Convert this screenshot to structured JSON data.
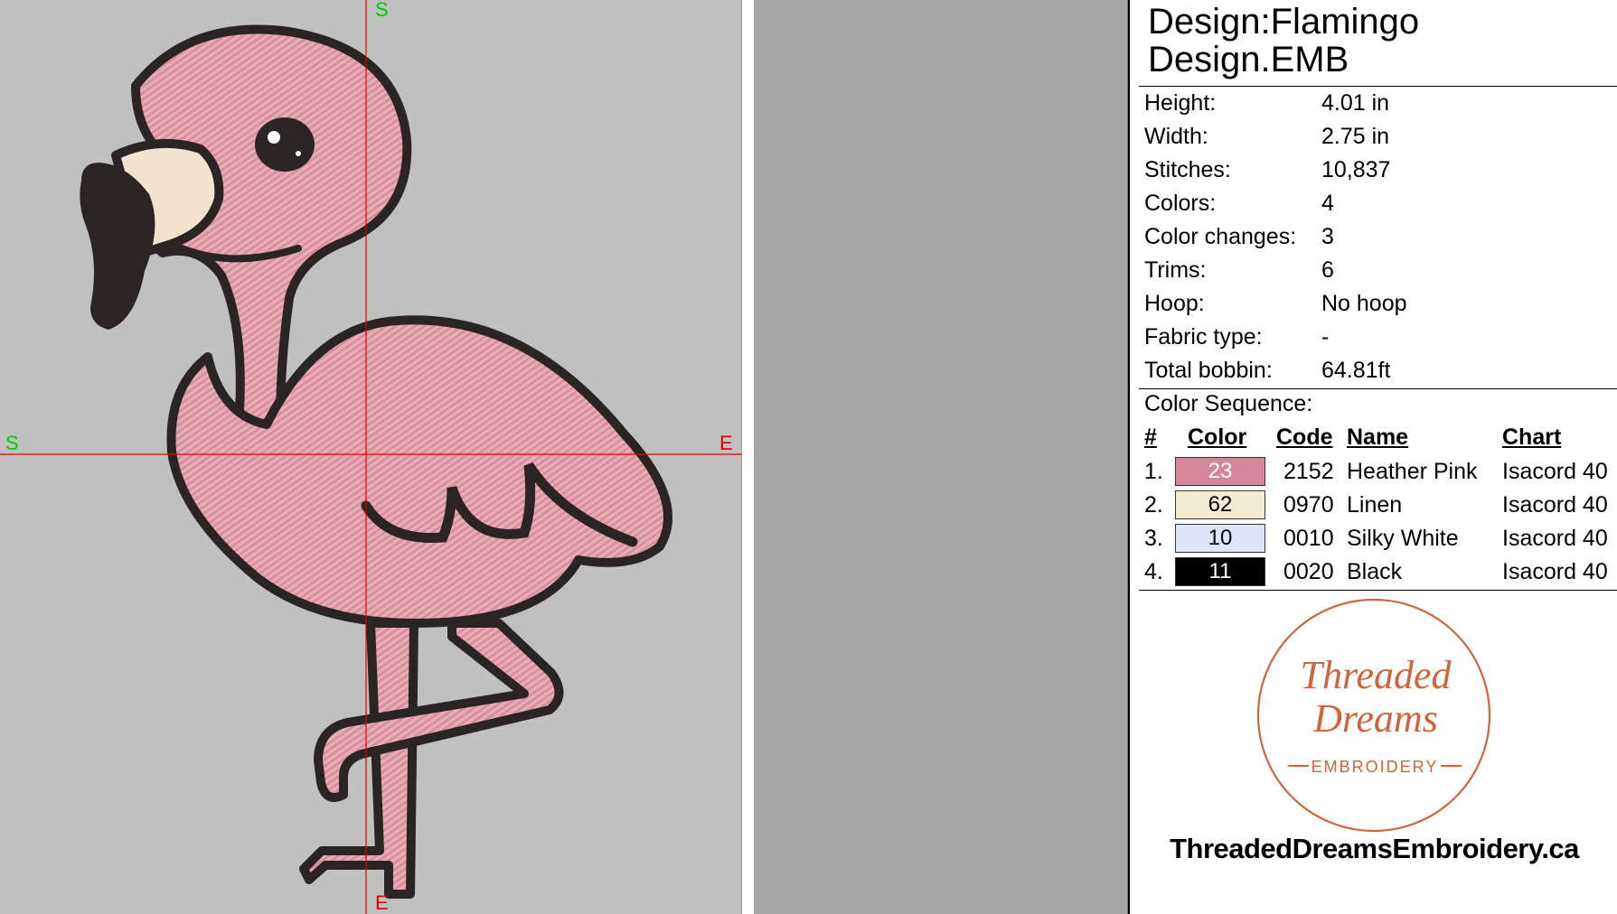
{
  "canvas": {
    "axis_labels": {
      "top": "S",
      "bottom": "E",
      "left": "S",
      "right": "E"
    },
    "colors": {
      "background": "#c0c0c0",
      "crosshair": "#e00000",
      "start_marker": "#00cc00"
    }
  },
  "design": {
    "title_line1": "Design:Flamingo",
    "title_line2": "Design.EMB"
  },
  "properties": [
    {
      "label": "Height:",
      "value": "4.01 in"
    },
    {
      "label": "Width:",
      "value": "2.75 in"
    },
    {
      "label": "Stitches:",
      "value": "10,837"
    },
    {
      "label": "Colors:",
      "value": "4"
    },
    {
      "label": "Color changes:",
      "value": "3"
    },
    {
      "label": "Trims:",
      "value": "6"
    },
    {
      "label": "Hoop:",
      "value": "No hoop"
    },
    {
      "label": "Fabric type:",
      "value": "-"
    },
    {
      "label": "Total bobbin:",
      "value": "64.81ft"
    }
  ],
  "color_sequence": {
    "heading": "Color Sequence:",
    "columns": {
      "num": "#",
      "color": "Color",
      "code": "Code",
      "name": "Name",
      "chart": "Chart"
    },
    "rows": [
      {
        "num": "1.",
        "swatch": "23",
        "swatch_color": "#d7879a",
        "swatch_text_color": "#ffffff",
        "code": "2152",
        "name": "Heather Pink",
        "chart": "Isacord 40"
      },
      {
        "num": "2.",
        "swatch": "62",
        "swatch_color": "#f3ecd3",
        "swatch_text_color": "#000000",
        "code": "0970",
        "name": "Linen",
        "chart": "Isacord 40"
      },
      {
        "num": "3.",
        "swatch": "10",
        "swatch_color": "#dde5f8",
        "swatch_text_color": "#000000",
        "code": "0010",
        "name": "Silky White",
        "chart": "Isacord 40"
      },
      {
        "num": "4.",
        "swatch": "11",
        "swatch_color": "#000000",
        "swatch_text_color": "#ffffff",
        "code": "0020",
        "name": "Black",
        "chart": "Isacord 40"
      }
    ]
  },
  "logo": {
    "line1": "Threaded",
    "line2": "Dreams",
    "line3": "EMBROIDERY",
    "color": "#d0643a"
  },
  "website": "ThreadedDreamsEmbroidery.ca",
  "flamingo_colors": {
    "body": "#e3a2ad",
    "outline": "#2b2424",
    "beak_light": "#f1e3d0",
    "eye_shine": "#ffffff"
  }
}
